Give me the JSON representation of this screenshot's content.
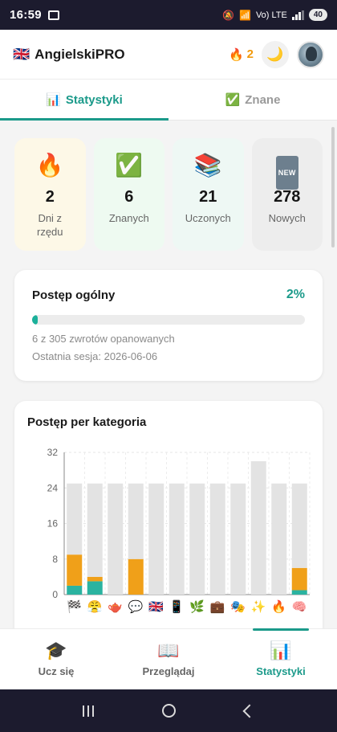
{
  "status_bar": {
    "time": "16:59",
    "network_label": "Vo) LTE",
    "battery": "40"
  },
  "header": {
    "flag": "🇬🇧",
    "title": "AngielskiPRO",
    "streak_icon": "🔥",
    "streak_count": "2",
    "theme_icon": "🌙",
    "avatar_icon": "avatar-photo"
  },
  "tabs": [
    {
      "icon": "📊",
      "label": "Statystyki",
      "active": true
    },
    {
      "icon": "✅",
      "label": "Znane",
      "active": false
    }
  ],
  "stats": [
    {
      "icon": "🔥",
      "value": "2",
      "label": "Dni z rzędu"
    },
    {
      "icon": "✅",
      "value": "6",
      "label": "Znanych"
    },
    {
      "icon": "📚",
      "value": "21",
      "label": "Uczonych"
    },
    {
      "icon": "NEW",
      "value": "278",
      "label": "Nowych"
    }
  ],
  "progress": {
    "title": "Postęp ogólny",
    "percent_label": "2%",
    "percent_value": 0.02,
    "summary": "6 z 305 zwrotów opanowanych",
    "last_session": "Ostatnia sesja: 2026-06-06"
  },
  "chart_data": {
    "type": "bar",
    "stacked": true,
    "title": "Postęp per kategoria",
    "categories": [
      "🏁",
      "😤",
      "🫖",
      "💬",
      "🇬🇧",
      "📱",
      "🌿",
      "💼",
      "🎭",
      "✨",
      "🔥",
      "🧠"
    ],
    "series": [
      {
        "color": "#2bb3a0",
        "values": [
          2,
          3,
          0,
          0,
          0,
          0,
          0,
          0,
          0,
          0,
          0,
          1
        ]
      },
      {
        "color": "#f0a019",
        "values": [
          7,
          1,
          0,
          8,
          0,
          0,
          0,
          0,
          0,
          0,
          0,
          5
        ]
      },
      {
        "color": "#e3e3e3",
        "values": [
          16,
          21,
          25,
          17,
          25,
          25,
          25,
          25,
          25,
          30,
          25,
          19
        ]
      }
    ],
    "y_ticks": [
      "0",
      "8",
      "16",
      "24",
      "32"
    ],
    "ylim": [
      0,
      32
    ],
    "grid": true
  },
  "bottom_nav": [
    {
      "icon": "🎓",
      "label": "Ucz się",
      "active": false
    },
    {
      "icon": "📖",
      "label": "Przeglądaj",
      "active": false
    },
    {
      "icon": "📊",
      "label": "Statystyki",
      "active": true
    }
  ]
}
